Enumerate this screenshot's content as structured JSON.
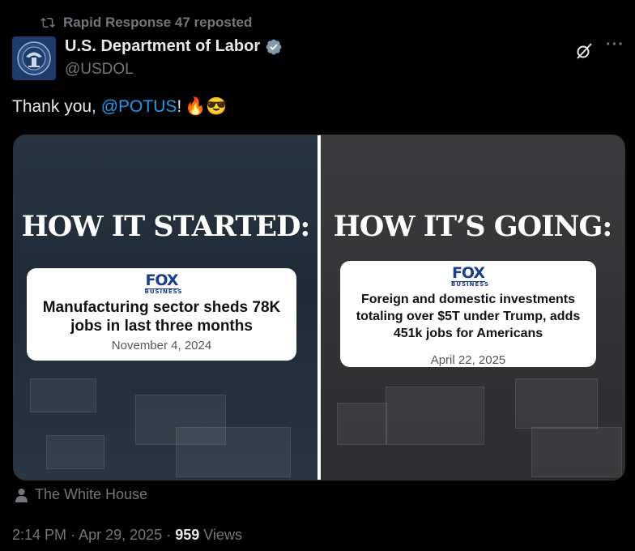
{
  "repost": {
    "text": "Rapid Response 47 reposted"
  },
  "author": {
    "name": "U.S. Department of Labor",
    "handle": "@USDOL"
  },
  "tweet": {
    "prefix": "Thank you, ",
    "mention": "@POTUS",
    "suffix": "!",
    "emoji": "🔥😎"
  },
  "media": {
    "left": {
      "heading": "HOW IT STARTED:",
      "logo_main": "FOX",
      "logo_sub": "BUSINESS",
      "headline": "Manufacturing sector sheds 78K jobs in last three months",
      "date": "November 4, 2024"
    },
    "right": {
      "heading": "HOW IT’S GOING:",
      "logo_main": "FOX",
      "logo_sub": "BUSINESS",
      "headline": "Foreign and domestic investments totaling over $5T under Trump, adds 451k jobs for Americans",
      "date": "April 22, 2025"
    }
  },
  "attribution": {
    "text": "The White House"
  },
  "meta": {
    "time": "2:14 PM",
    "date": "Apr 29, 2025",
    "views_count": "959",
    "views_label": "Views",
    "sep": "·"
  },
  "colors": {
    "accent": "#1d9bf0",
    "muted": "#71767b",
    "text": "#e7e9ea",
    "background": "#000000"
  },
  "icons": [
    "repost-icon",
    "verified-badge-icon",
    "grok-icon",
    "more-icon",
    "person-icon"
  ]
}
